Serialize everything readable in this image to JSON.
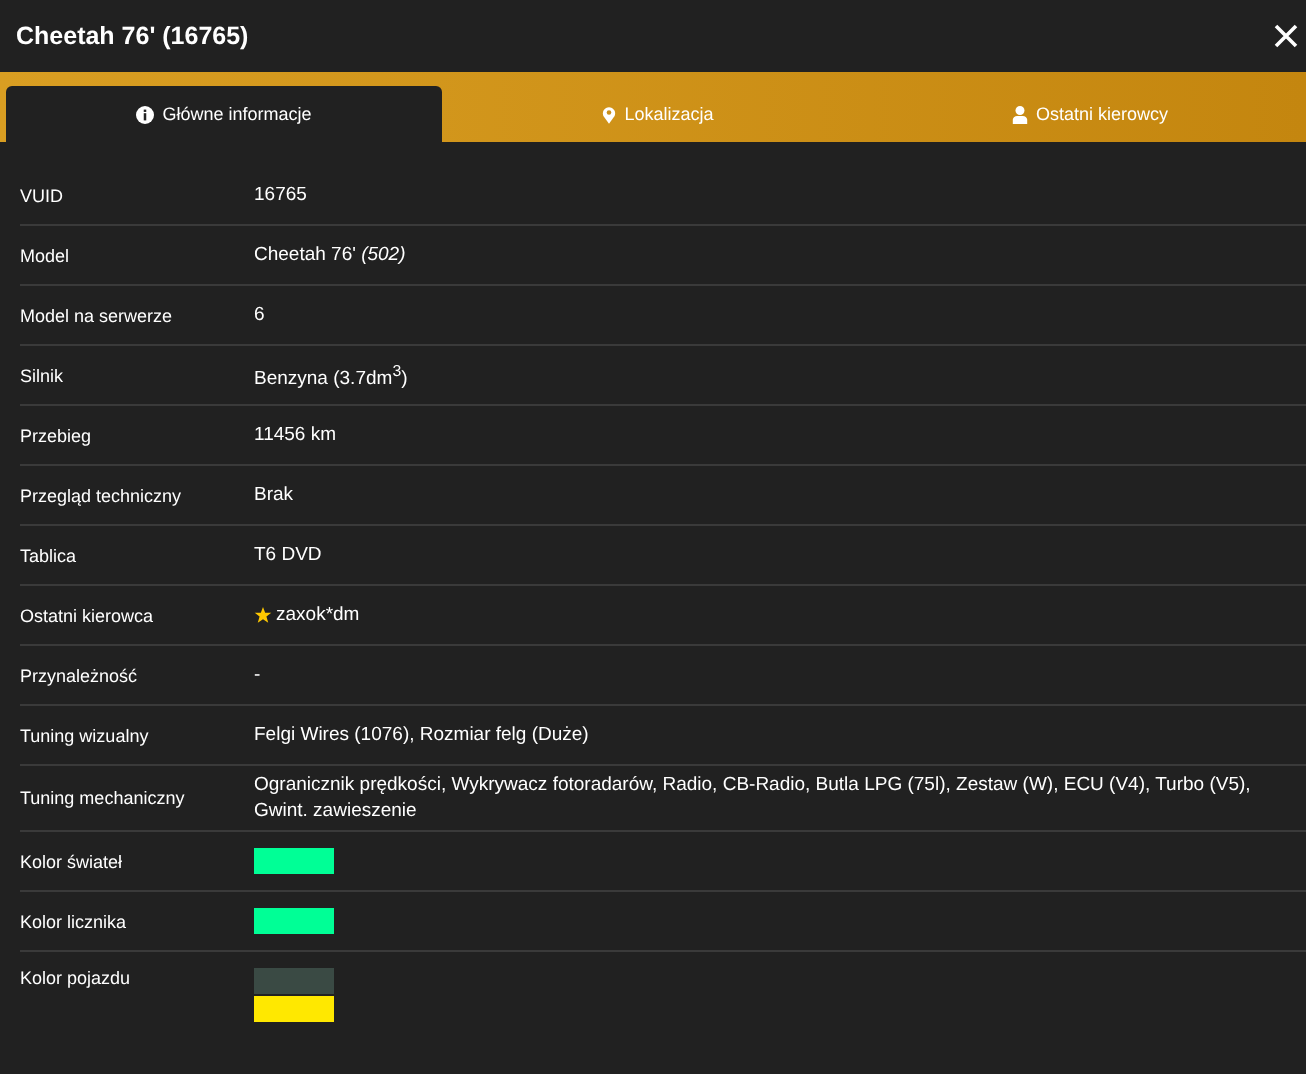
{
  "window": {
    "title": "Cheetah 76' (16765)"
  },
  "tabs": [
    {
      "label": "Główne informacje",
      "kind": "info",
      "selected": true
    },
    {
      "label": "Lokalizacja",
      "kind": "location",
      "selected": false
    },
    {
      "label": "Ostatni kierowcy",
      "kind": "drivers",
      "selected": false
    }
  ],
  "rows": [
    {
      "kind": "text",
      "label": "VUID",
      "value": "16765"
    },
    {
      "kind": "text",
      "label": "Model",
      "value": "Cheetah 76' *(502)*"
    },
    {
      "kind": "text",
      "label": "Model na serwerze",
      "value": "6"
    },
    {
      "kind": "text",
      "label": "Silnik",
      "value": "Benzyna (3.7dm$^{3}$)"
    },
    {
      "kind": "text",
      "label": "Przebieg",
      "value": "11456 km"
    },
    {
      "kind": "text",
      "label": "Przegląd techniczny",
      "value": "Brak"
    },
    {
      "kind": "text",
      "label": "Tablica",
      "value": "T6 DVD"
    },
    {
      "kind": "driver",
      "label": "Ostatni kierowca",
      "value": "zaxok*dm"
    },
    {
      "kind": "text",
      "label": "Przynależność",
      "value": "-"
    },
    {
      "kind": "text",
      "label": "Tuning wizualny",
      "value": "Felgi Wires (1076), Rozmiar felg (Duże)"
    },
    {
      "kind": "text",
      "label": "Tuning mechaniczny",
      "value": "Ogranicznik prędkości, Wykrywacz fotoradarów, Radio, CB-Radio, Butla LPG (75l), Zestaw (W), ECU (V4), Turbo (V5), Gwint. zawieszenie"
    },
    {
      "kind": "colors",
      "label": "Kolor świateł",
      "colors": [
        {
          "color": "#00ff96"
        }
      ]
    },
    {
      "kind": "colors",
      "label": "Kolor licznika",
      "colors": [
        {
          "color": "#00ff96"
        }
      ]
    },
    {
      "kind": "colors",
      "label": "Kolor pojazdu",
      "colors": [
        {
          "color": "#3a4a44"
        },
        {
          "color": "#ffe800"
        }
      ]
    }
  ]
}
